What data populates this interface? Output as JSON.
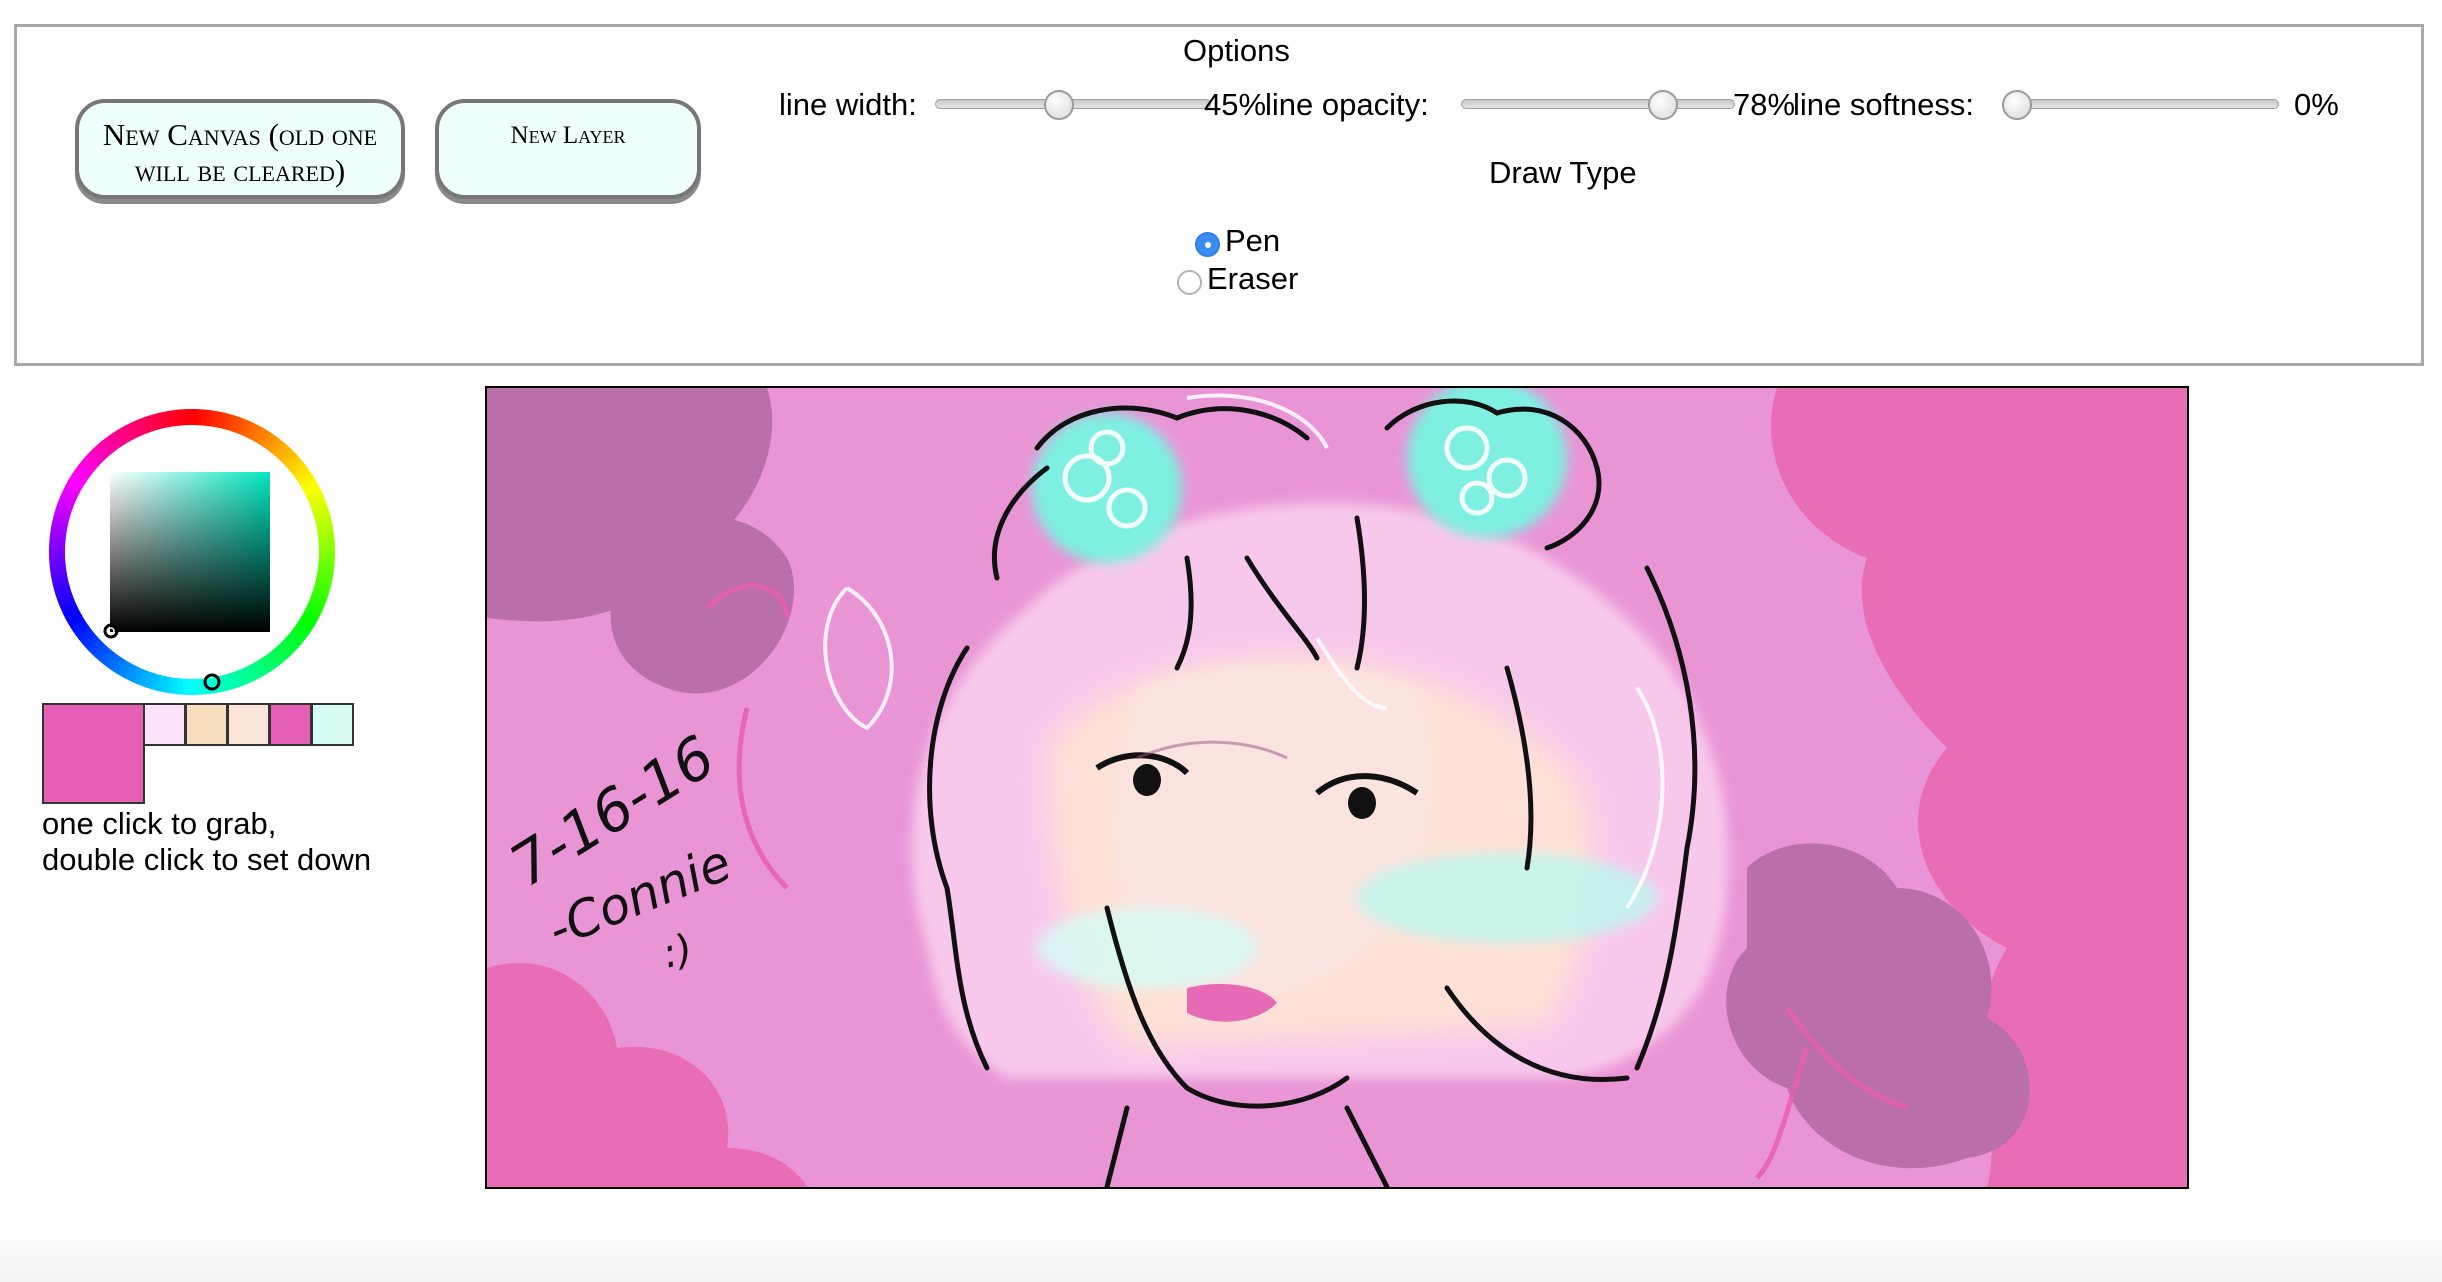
{
  "options": {
    "legend": "Options",
    "new_canvas_label": "New Canvas (old one will be cleared)",
    "new_layer_label": "New Layer",
    "line_width": {
      "label": "line width:",
      "value": 45,
      "display": "45%"
    },
    "line_opacity": {
      "label": "line opacity:",
      "value": 78,
      "display": "78%"
    },
    "line_softness": {
      "label": "line softness:",
      "value": 0,
      "display": "0%"
    },
    "draw_type": {
      "label": "Draw Type",
      "options": [
        "Pen",
        "Eraser"
      ],
      "selected": "Pen"
    }
  },
  "colors": {
    "current": "#e55fb5",
    "palette": [
      "#fde3f7",
      "#f8dcc0",
      "#fbe5db",
      "#e55fb5",
      "#d6fbf5"
    ],
    "hint": "one click to grab,\ndouble click to set down"
  },
  "canvas": {
    "background": "#e995d5",
    "signature_lines": [
      "7-16-16",
      "-Connie",
      ":)"
    ]
  }
}
